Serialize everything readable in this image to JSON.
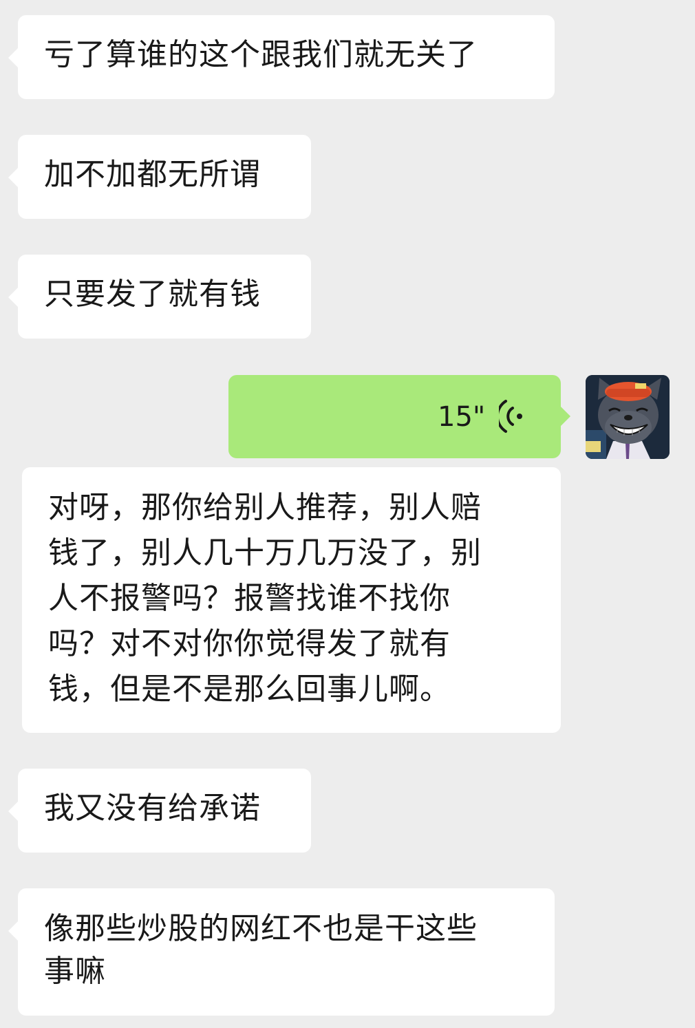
{
  "messages": {
    "m1": "亏了算谁的这个跟我们就无关了",
    "m2": "加不加都无所谓",
    "m3": "只要发了就有钱",
    "voice_duration": "15\"",
    "m5_lines": [
      "对呀，那你给别人推荐，别人赔",
      "钱了，别人几十万几万没了，别",
      "人不报警吗？报警找谁不找你",
      "吗？对不对你你觉得发了就有",
      "钱，但是不是那么回事儿啊。"
    ],
    "m6": "我又没有给承诺",
    "m7_lines": [
      "像那些炒股的网红不也是干这些",
      "事嘛"
    ]
  },
  "colors": {
    "background": "#ededed",
    "received_bubble": "#ffffff",
    "sent_bubble": "#a9e97a",
    "text": "#191919"
  },
  "icons": {
    "voice": "voice-wave-icon",
    "avatar": "cartoon-wolf-avatar"
  }
}
